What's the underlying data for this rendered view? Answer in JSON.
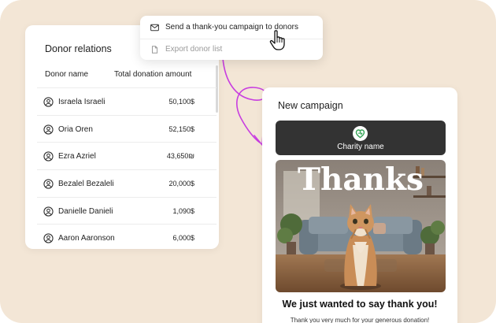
{
  "donor_panel": {
    "title": "Donor relations",
    "columns": {
      "name": "Donor name",
      "amount": "Total donation amount"
    },
    "rows": [
      {
        "name": "Israela Israeli",
        "amount": "50,100$"
      },
      {
        "name": "Oria Oren",
        "amount": "52,150$"
      },
      {
        "name": "Ezra Azriel",
        "amount": "43,650₪"
      },
      {
        "name": "Bezalel Bezaleli",
        "amount": "20,000$"
      },
      {
        "name": "Danielle Danieli",
        "amount": "1,090$"
      },
      {
        "name": "Aaron Aaronson",
        "amount": "6,000$"
      }
    ]
  },
  "context_menu": {
    "items": [
      {
        "label": "Send a thank-you campaign to donors",
        "icon": "mail-icon"
      },
      {
        "label": "Export donor list",
        "icon": "file-icon"
      }
    ]
  },
  "campaign_panel": {
    "title": "New campaign",
    "charity_name": "Charity name",
    "hero_word": "Thanks",
    "heading": "We just wanted to say thank you!",
    "body": "Thank you very much for your generous donation!"
  },
  "colors": {
    "background": "#f3e6d6",
    "banner": "#333333",
    "accent_arrow": "#c83ee0",
    "logo_green": "#3aa55a"
  }
}
